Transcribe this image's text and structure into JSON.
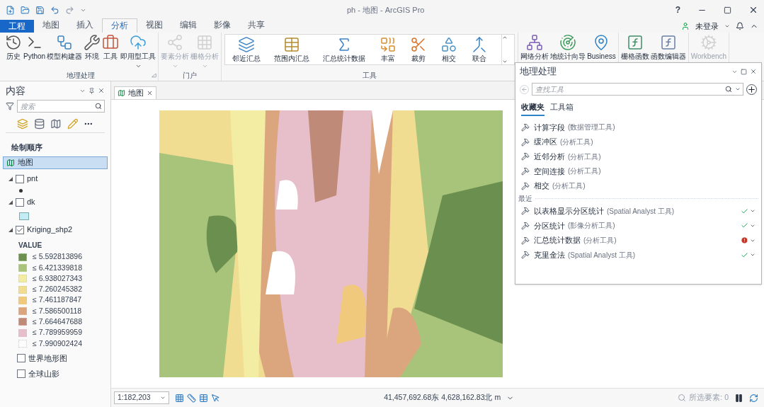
{
  "title_bar": {
    "title": "ph - 地图 - ArcGIS Pro",
    "help": "?"
  },
  "ribbon": {
    "tabs": [
      {
        "label": "工程",
        "kind": "file",
        "selected": false
      },
      {
        "label": "地图",
        "kind": "tab",
        "selected": false
      },
      {
        "label": "插入",
        "kind": "tab",
        "selected": false
      },
      {
        "label": "分析",
        "kind": "tab",
        "selected": true
      },
      {
        "label": "视图",
        "kind": "tab",
        "selected": false
      },
      {
        "label": "编辑",
        "kind": "tab",
        "selected": false
      },
      {
        "label": "影像",
        "kind": "tab",
        "selected": false
      },
      {
        "label": "共享",
        "kind": "tab",
        "selected": false
      }
    ],
    "account": "未登录",
    "groups": [
      {
        "label": "地理处理",
        "kind": "large",
        "buttons": [
          {
            "label": "历史",
            "disabled": false,
            "dropdown": false
          },
          {
            "label": "Python",
            "disabled": false,
            "dropdown": false
          },
          {
            "label": "模型构建器",
            "disabled": false,
            "dropdown": false
          },
          {
            "label": "环境",
            "disabled": false,
            "dropdown": false
          },
          {
            "label": "工具",
            "disabled": false,
            "dropdown": false
          },
          {
            "label": "即用型工具",
            "disabled": false,
            "dropdown": true
          }
        ]
      },
      {
        "label": "门户",
        "kind": "large",
        "buttons": [
          {
            "label": "要素分析",
            "disabled": true,
            "dropdown": true
          },
          {
            "label": "栅格分析",
            "disabled": true,
            "dropdown": true
          }
        ]
      },
      {
        "label": "工具",
        "kind": "gallery",
        "buttons": [
          {
            "label": "邻近汇总",
            "disabled": false,
            "dropdown": false
          },
          {
            "label": "范围内汇总",
            "disabled": false,
            "dropdown": false
          },
          {
            "label": "汇总统计数据",
            "disabled": false,
            "dropdown": false
          },
          {
            "label": "丰富",
            "disabled": false,
            "dropdown": false
          },
          {
            "label": "裁剪",
            "disabled": false,
            "dropdown": false
          },
          {
            "label": "相交",
            "disabled": false,
            "dropdown": false
          },
          {
            "label": "联合",
            "disabled": false,
            "dropdown": false
          }
        ]
      },
      {
        "kind": "large",
        "buttons": [
          {
            "label": "网络分析",
            "disabled": false,
            "dropdown": false
          },
          {
            "label": "地统计向导",
            "disabled": false,
            "dropdown": false
          },
          {
            "label": "Business",
            "disabled": false,
            "dropdown": false
          }
        ]
      },
      {
        "kind": "large",
        "buttons": [
          {
            "label": "栅格函数",
            "disabled": false,
            "dropdown": false
          },
          {
            "label": "函数编辑器",
            "disabled": false,
            "dropdown": false
          }
        ]
      },
      {
        "kind": "large",
        "buttons": [
          {
            "label": "Workbench",
            "disabled": true,
            "dropdown": false
          }
        ]
      }
    ]
  },
  "contents": {
    "title": "内容",
    "search": {
      "placeholder": "搜索"
    },
    "heading": "绘制顺序",
    "map": {
      "label": "地图",
      "selected": true,
      "children": [
        {
          "label": "pnt",
          "kind": "point",
          "checked": false,
          "expanded": true
        },
        {
          "label": "dk",
          "kind": "polygon",
          "checked": false,
          "expanded": true
        },
        {
          "label": "Kriging_shp2",
          "kind": "classes",
          "checked": true,
          "expanded": true,
          "legend_title": "VALUE",
          "classes": [
            {
              "label": "≤ 5.592813896",
              "color": "#6b8f4f"
            },
            {
              "label": "≤ 6.421339818",
              "color": "#a8c47a"
            },
            {
              "label": "≤ 6.938027343",
              "color": "#f2eda3"
            },
            {
              "label": "≤ 7.260245382",
              "color": "#f1dd92"
            },
            {
              "label": "≤ 7.461187847",
              "color": "#f1c97c"
            },
            {
              "label": "≤ 7.586500118",
              "color": "#dba67e"
            },
            {
              "label": "≤ 7.664647688",
              "color": "#bf8a78"
            },
            {
              "label": "≤ 7.789959959",
              "color": "#e7bfca"
            },
            {
              "label": "≤ 7.990902424",
              "color": "#ffffff"
            }
          ]
        },
        {
          "label": "世界地形图",
          "kind": "basemap",
          "checked": false
        },
        {
          "label": "全球山影",
          "kind": "basemap",
          "checked": false
        }
      ]
    }
  },
  "map_view": {
    "tab": {
      "label": "地图",
      "selected": true
    }
  },
  "status_bar": {
    "scale": "1:182,203",
    "coordinates": "41,457,692.68东 4,628,162.83北 m",
    "selected_features": "所选要素: 0"
  },
  "geoprocessing": {
    "title": "地理处理",
    "search": {
      "placeholder": "查找工具"
    },
    "tabs": [
      {
        "label": "收藏夹",
        "selected": true
      },
      {
        "label": "工具箱",
        "selected": false
      }
    ],
    "favorites": [
      {
        "name": "计算字段",
        "toolbox": "(数据管理工具)"
      },
      {
        "name": "缓冲区",
        "toolbox": "(分析工具)"
      },
      {
        "name": "近邻分析",
        "toolbox": "(分析工具)"
      },
      {
        "name": "空间连接",
        "toolbox": "(分析工具)"
      },
      {
        "name": "相交",
        "toolbox": "(分析工具)"
      }
    ],
    "recent_heading": "最近",
    "recent": [
      {
        "name": "以表格显示分区统计",
        "toolbox": "(Spatial Analyst 工具)",
        "succeeded": true
      },
      {
        "name": "分区统计",
        "toolbox": "(影像分析工具)",
        "succeeded": true
      },
      {
        "name": "汇总统计数据",
        "toolbox": "(分析工具)",
        "succeeded": false
      },
      {
        "name": "克里金法",
        "toolbox": "(Spatial Analyst 工具)",
        "succeeded": true
      }
    ]
  }
}
